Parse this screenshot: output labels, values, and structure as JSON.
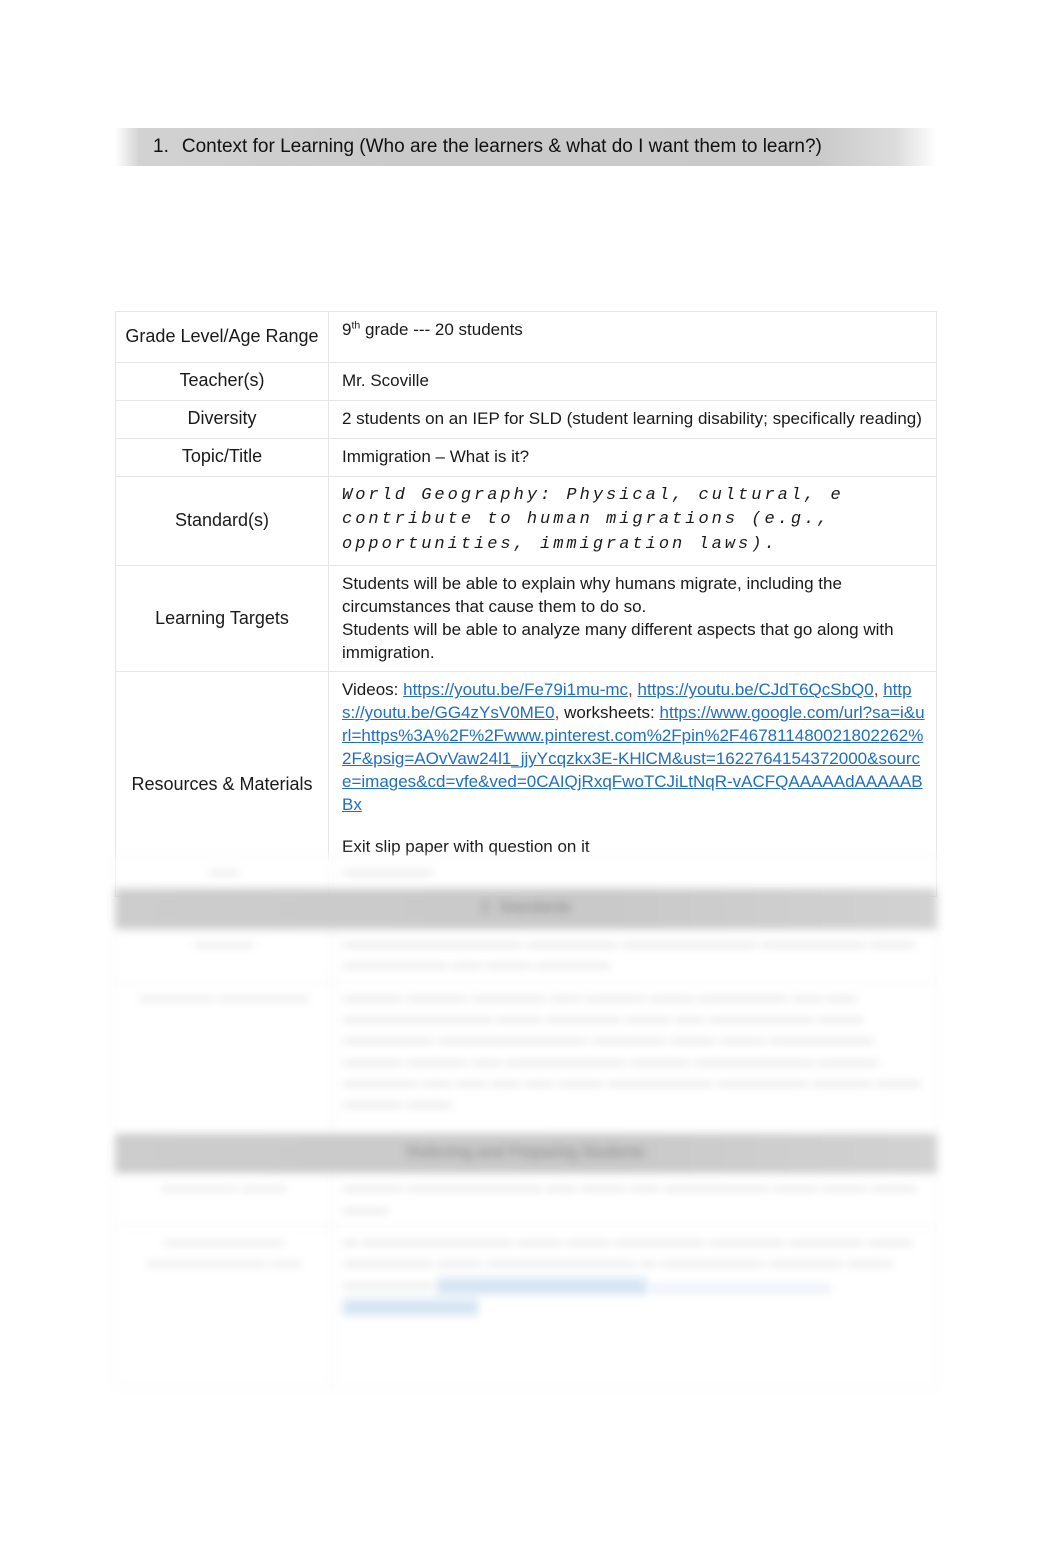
{
  "document": {
    "type": "lesson-plan",
    "page_background": "#ffffff"
  },
  "section_header": {
    "number": "1.",
    "title": "Context for Learning (Who are the learners & what do I want them to learn?)",
    "bar_color": "#c9c9c9"
  },
  "table": {
    "rows": [
      {
        "label": "Grade Level/Age Range",
        "value_prefix": "9",
        "value_sup": "th",
        "value_suffix": " grade --- 20 students"
      },
      {
        "label": "Teacher(s)",
        "value": "Mr. Scoville"
      },
      {
        "label": "Diversity",
        "value": "2 students on an IEP for SLD (student learning disability; specifically reading)"
      },
      {
        "label": "Topic/Title",
        "value": "Immigration – What is it?"
      },
      {
        "label": "Standard(s)",
        "standard_lines": [
          "World Geography: Physical, cultural, e",
          "contribute to human migrations (e.g.,",
          "opportunities, immigration laws)."
        ]
      },
      {
        "label": "Learning Targets",
        "targets": [
          "Students will be able to explain why humans migrate, including the circumstances that cause them to do so.",
          "Students will be able to analyze many different aspects that go along with immigration."
        ]
      },
      {
        "label": "Resources & Materials",
        "videos_label": "Videos: ",
        "video_links": [
          "https://youtu.be/Fe79i1mu-mc",
          "https://youtu.be/CJdT6QcSbQ0",
          "https://youtu.be/GG4zYsV0ME0"
        ],
        "worksheets_label": "worksheets: ",
        "worksheet_link": "https://www.google.com/url?sa=i&url=https%3A%2F%2Fwww.pinterest.com%2Fpin%2F467811480021802262%2F&psig=AOvVaw24l1_jjyYcqzkx3E-KHlCM&ust=1622764154372000&source=images&cd=vfe&ved=0CAIQjRxqFwoTCJiLtNqR-vACFQAAAAAdAAAAABBx",
        "extra_line": "Exit slip paper with question on it"
      }
    ]
  },
  "colors": {
    "link": "#1f6fc4",
    "text": "#1a1a1a",
    "punctuation_red": "#b02418",
    "bar_gray": "#c9c9c9",
    "cell_border": "#e6e6e6"
  },
  "blurred_section": {
    "note": "out-of-focus lower page content",
    "rows": [
      {
        "label": "——",
        "value": "——————"
      },
      {
        "bar": "2.  Standards"
      },
      {
        "label": "————",
        "value": "———————————— —————— ————————— ——————— ——— ——————— —— ——— —————"
      },
      {
        "label": "————— ——————",
        "value": "———— ———— ————— —— ———— ——— —————— —— —— —————————— ——— ————— ——— —— ——————— ——— —————— —————————— ————— ——— ——— ——————— ———— ———— —— ———————— ———— ———————— ———— ————— —— —— —— —— ——— ——————— —————— ———— ——— ———— ———"
      },
      {
        "bar": "Referring and Preparing Students"
      },
      {
        "label": "————— ———",
        "value": "———— ————————— —— ——— —— ——————— ——— ——— ——— ———"
      },
      {
        "label": "———————— ———————— ——",
        "value": "— —————————— ——— ——— —————— ————— ————— ——— —————— ——— —————————— — ——————— ————— ——— ——————"
      }
    ]
  }
}
